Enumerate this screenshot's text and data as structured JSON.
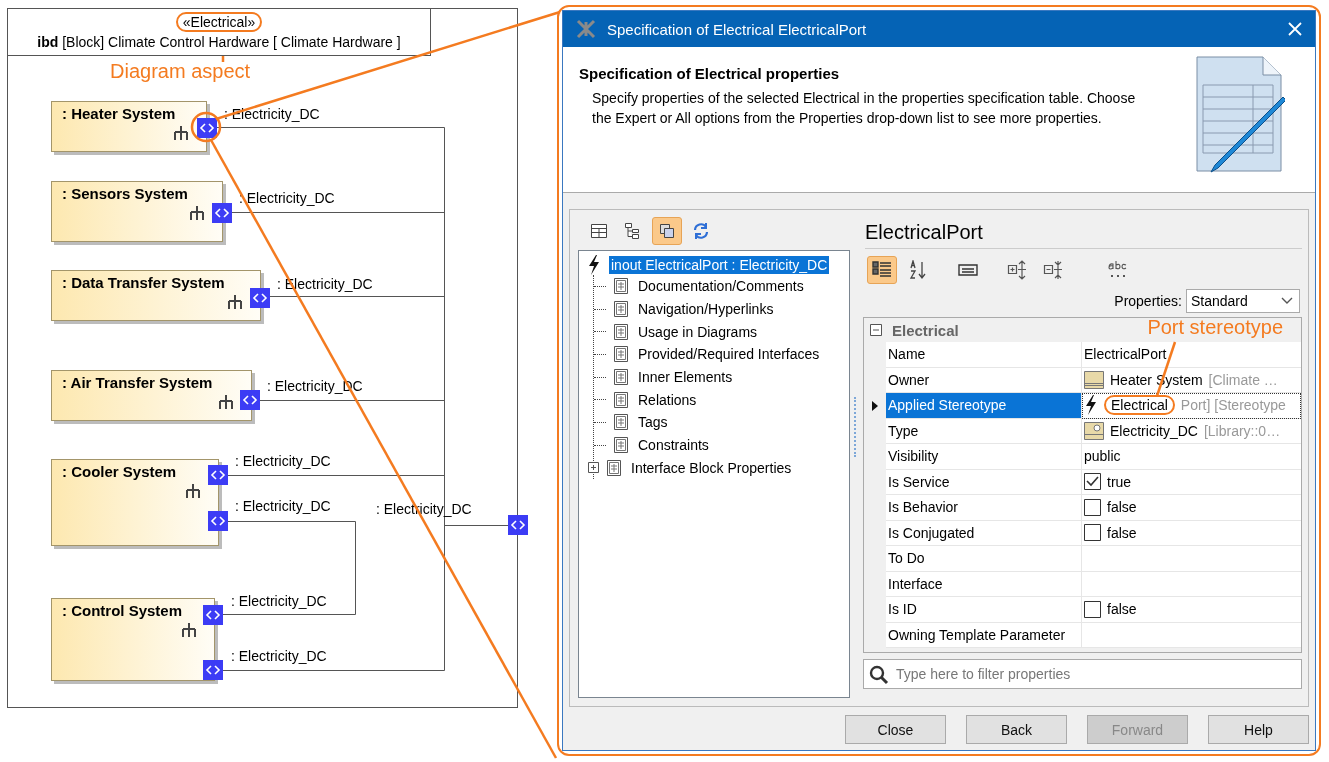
{
  "diagram": {
    "stereotype": "«Electrical»",
    "header": "**ibd** [Block] Climate Control Hardware [ Climate Hardware ]",
    "parts": [
      {
        "name": ": Heater System",
        "ports": [
          ": Electricity_DC"
        ]
      },
      {
        "name": ": Sensors System",
        "ports": [
          ": Electricity_DC"
        ]
      },
      {
        "name": ": Data Transfer System",
        "ports": [
          ": Electricity_DC"
        ]
      },
      {
        "name": ": Air Transfer System",
        "ports": [
          ": Electricity_DC"
        ]
      },
      {
        "name": ": Cooler System",
        "ports": [
          ": Electricity_DC",
          ": Electricity_DC"
        ]
      },
      {
        "name": ": Control System",
        "ports": [
          ": Electricity_DC",
          ": Electricity_DC"
        ]
      }
    ],
    "boundary_port": ": Electricity_DC"
  },
  "annotations": [
    {
      "text": "Diagram aspect"
    },
    {
      "text": "Port stereotype"
    }
  ],
  "dialog": {
    "title": "Specification of Electrical ElectricalPort",
    "heading": "Specification of Electrical properties",
    "description": "Specify properties of the selected Electrical in the properties specification table. Choose the Expert or All options from the Properties drop-down list to see more properties.",
    "left_toolbar": [
      {
        "kind": "table",
        "selected": false
      },
      {
        "kind": "tree",
        "selected": false
      },
      {
        "kind": "overlap",
        "selected": true
      },
      {
        "kind": "refresh",
        "selected": false
      }
    ],
    "tree": {
      "label": "inout ElectricalPort : Electricity_DC",
      "selected": true,
      "children": [
        {
          "label": "Documentation/Comments",
          "kind": "leaf",
          "selected": false
        },
        {
          "label": "Navigation/Hyperlinks",
          "kind": "leaf",
          "selected": false
        },
        {
          "label": "Usage in Diagrams",
          "kind": "leaf",
          "selected": false
        },
        {
          "label": "Provided/Required Interfaces",
          "kind": "leaf",
          "selected": false
        },
        {
          "label": "Inner Elements",
          "kind": "leaf",
          "selected": false
        },
        {
          "label": "Relations",
          "kind": "leaf",
          "selected": false
        },
        {
          "label": "Tags",
          "kind": "leaf",
          "selected": false
        },
        {
          "label": "Constraints",
          "kind": "leaf",
          "selected": false
        },
        {
          "label": "Interface Block Properties",
          "kind": "collapsed",
          "selected": false
        }
      ]
    },
    "element_title": "ElectricalPort",
    "right_toolbar": [
      {
        "kind": "categorized",
        "selected": true
      },
      {
        "kind": "sort",
        "selected": false
      },
      {
        "kind": "description",
        "selected": false
      },
      {
        "kind": "expand",
        "selected": false
      },
      {
        "kind": "collapse",
        "selected": false
      },
      {
        "kind": "spelling",
        "selected": false
      }
    ],
    "properties_label": "Properties:",
    "properties_value": "Standard",
    "group": {
      "name": "Electrical",
      "expanded": true
    },
    "rows": [
      {
        "name": "Name",
        "kind": "text",
        "value": "ElectricalPort",
        "selected": false
      },
      {
        "name": "Owner",
        "kind": "block_ref",
        "value": "Heater System",
        "qualifier": "[Climate …",
        "selected": false
      },
      {
        "name": "Applied Stereotype",
        "kind": "stereotype",
        "value": "Electrical",
        "qualifier": "Port] [Stereotype",
        "selected": true
      },
      {
        "name": "Type",
        "kind": "type_ref",
        "value": "Electricity_DC",
        "qualifier": "[Library::0…",
        "selected": false
      },
      {
        "name": "Visibility",
        "kind": "text",
        "value": "public",
        "selected": false
      },
      {
        "name": "Is Service",
        "kind": "checkbox",
        "checked": true,
        "value": "true",
        "selected": false
      },
      {
        "name": "Is Behavior",
        "kind": "checkbox",
        "checked": false,
        "value": "false",
        "selected": false
      },
      {
        "name": "Is Conjugated",
        "kind": "checkbox",
        "checked": false,
        "value": "false",
        "selected": false
      },
      {
        "name": "To Do",
        "kind": "empty",
        "selected": false
      },
      {
        "name": "Interface",
        "kind": "empty",
        "selected": false
      },
      {
        "name": "Is ID",
        "kind": "checkbox",
        "checked": false,
        "value": "false",
        "selected": false
      },
      {
        "name": "Owning Template Parameter",
        "kind": "empty",
        "selected": false
      }
    ],
    "filter_placeholder": "Type here to filter properties",
    "buttons": [
      {
        "label": "Close",
        "disabled": false
      },
      {
        "label": "Back",
        "disabled": false
      },
      {
        "label": "Forward",
        "disabled": true
      },
      {
        "label": "Help",
        "disabled": false
      }
    ]
  }
}
